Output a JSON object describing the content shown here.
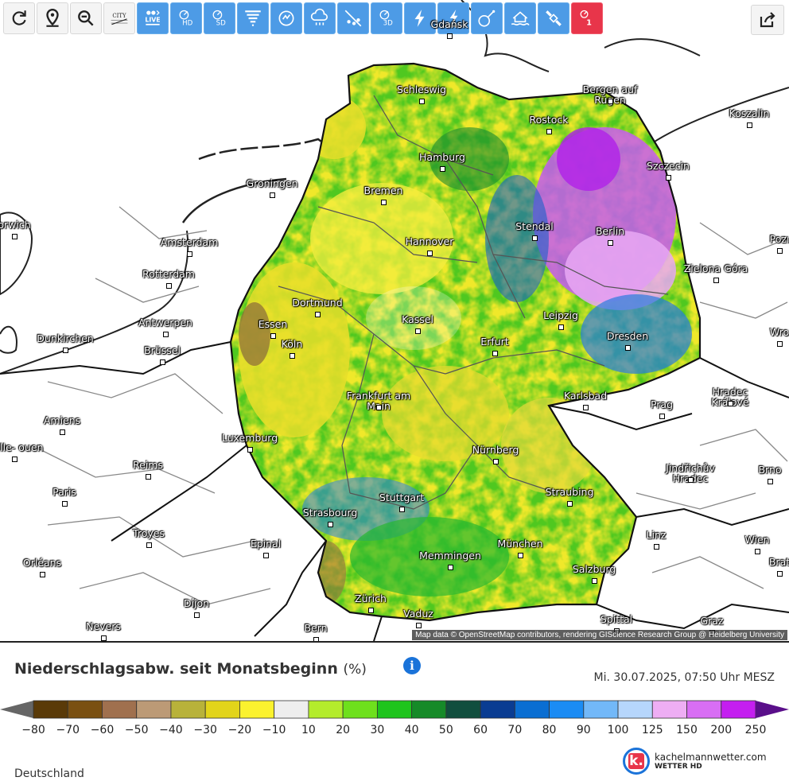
{
  "toolbar": {
    "buttons": [
      {
        "name": "refresh-button",
        "icon": "refresh-icon",
        "style": "white"
      },
      {
        "name": "location-button",
        "icon": "location-pin-icon",
        "style": "white"
      },
      {
        "name": "zoom-out-button",
        "icon": "zoom-out-icon",
        "style": "white"
      },
      {
        "name": "city-toggle-button",
        "icon": "city-icon",
        "style": "white",
        "label": "CITY"
      },
      {
        "name": "live-analyse-button",
        "icon": "live-icon",
        "style": "blue",
        "label": "LIVE"
      },
      {
        "name": "radar-hd-button",
        "icon": "radar-hd-icon",
        "style": "blue",
        "label": "HD"
      },
      {
        "name": "radar-sd-button",
        "icon": "radar-sd-icon",
        "style": "blue",
        "label": "SD"
      },
      {
        "name": "tornado-button",
        "icon": "tornado-icon",
        "style": "blue"
      },
      {
        "name": "storm-track-button",
        "icon": "storm-track-icon",
        "style": "blue"
      },
      {
        "name": "precipitation-button",
        "icon": "rain-cloud-icon",
        "style": "blue"
      },
      {
        "name": "hail-button",
        "icon": "hail-icon",
        "style": "blue"
      },
      {
        "name": "radar-3d-button",
        "icon": "radar-3d-icon",
        "style": "blue",
        "label": "3D"
      },
      {
        "name": "lightning-button",
        "icon": "lightning-icon",
        "style": "blue"
      },
      {
        "name": "lightning-ground-button",
        "icon": "lightning-ground-icon",
        "style": "blue"
      },
      {
        "name": "satellite-dish-button",
        "icon": "satellite-dish-icon",
        "style": "blue"
      },
      {
        "name": "flood-button",
        "icon": "flood-icon",
        "style": "blue"
      },
      {
        "name": "satellite-button",
        "icon": "satellite-icon",
        "style": "blue"
      },
      {
        "name": "warning-button",
        "icon": "warning-radar-icon",
        "style": "red",
        "label": "1"
      }
    ]
  },
  "map": {
    "attribution": "Map data © OpenStreetMap contributors, rendering GIScience Research Group @ Heidelberg University",
    "cities": [
      {
        "name": "Gdańsk",
        "label": "Gdańsk"
      },
      {
        "name": "Schleswig",
        "label": "Schleswig"
      },
      {
        "name": "Bergen auf Rügen",
        "label": "Bergen auf Rügen"
      },
      {
        "name": "Rostock",
        "label": "Rostock"
      },
      {
        "name": "Koszalin",
        "label": "Koszalin"
      },
      {
        "name": "Hamburg",
        "label": "Hamburg"
      },
      {
        "name": "Szczecin",
        "label": "Szczecin"
      },
      {
        "name": "Groningen",
        "label": "Groningen"
      },
      {
        "name": "Bremen",
        "label": "Bremen"
      },
      {
        "name": "Norwich",
        "label": "orwich"
      },
      {
        "name": "Stendal",
        "label": "Stendal"
      },
      {
        "name": "Amsterdam",
        "label": "Amsterdam"
      },
      {
        "name": "Berlin",
        "label": "Berlin"
      },
      {
        "name": "Hannover",
        "label": "Hannover"
      },
      {
        "name": "Poznań",
        "label": "Pozı"
      },
      {
        "name": "Zielona Góra",
        "label": "Zielona Góra"
      },
      {
        "name": "Rotterdam",
        "label": "Rotterdam"
      },
      {
        "name": "Dortmund",
        "label": "Dortmund"
      },
      {
        "name": "Antwerpen",
        "label": "Antwerpen"
      },
      {
        "name": "Essen",
        "label": "Essen"
      },
      {
        "name": "Kassel",
        "label": "Kassel"
      },
      {
        "name": "Leipzig",
        "label": "Leipzig"
      },
      {
        "name": "Wrocław",
        "label": "Wro"
      },
      {
        "name": "Dunkirchen",
        "label": "Dunkirchen"
      },
      {
        "name": "Brüssel",
        "label": "Brüssel"
      },
      {
        "name": "Köln",
        "label": "Köln"
      },
      {
        "name": "Erfurt",
        "label": "Erfurt"
      },
      {
        "name": "Dresden",
        "label": "Dresden"
      },
      {
        "name": "Frankfurt am Main",
        "label": "Frankfurt am Main"
      },
      {
        "name": "Hradec Králové",
        "label": "Hradec Králové"
      },
      {
        "name": "Karlsbad",
        "label": "Karlsbad"
      },
      {
        "name": "Prag",
        "label": "Prag"
      },
      {
        "name": "Amiens",
        "label": "Amiens"
      },
      {
        "name": "Luxemburg",
        "label": "Luxemburg"
      },
      {
        "name": "Rouen",
        "label": "eville- ouen"
      },
      {
        "name": "Nürnberg",
        "label": "Nürnberg"
      },
      {
        "name": "Jindřichův Hradec",
        "label": "Jindřichův Hradec"
      },
      {
        "name": "Reims",
        "label": "Reims"
      },
      {
        "name": "Brno",
        "label": "Brno"
      },
      {
        "name": "Paris",
        "label": "Paris"
      },
      {
        "name": "Stuttgart",
        "label": "Stuttgart"
      },
      {
        "name": "Straubing",
        "label": "Straubing"
      },
      {
        "name": "Strasbourg",
        "label": "Strasbourg"
      },
      {
        "name": "Troyes",
        "label": "Troyes"
      },
      {
        "name": "Epinal",
        "label": "Epinal"
      },
      {
        "name": "Linz",
        "label": "Linz"
      },
      {
        "name": "München",
        "label": "München"
      },
      {
        "name": "Wien",
        "label": "Wien"
      },
      {
        "name": "Orléans",
        "label": "Orléans"
      },
      {
        "name": "Memmingen",
        "label": "Memmingen"
      },
      {
        "name": "Salzburg",
        "label": "Salzburg"
      },
      {
        "name": "Bratislava",
        "label": "Brat"
      },
      {
        "name": "Zürich",
        "label": "Zürich"
      },
      {
        "name": "Dijon",
        "label": "Dijon"
      },
      {
        "name": "Vaduz",
        "label": "Vaduz"
      },
      {
        "name": "Nevers",
        "label": "Nevers"
      },
      {
        "name": "Bern",
        "label": "Bern"
      },
      {
        "name": "Spittal",
        "label": "Spittal"
      },
      {
        "name": "Graz",
        "label": "Graz"
      }
    ]
  },
  "legend": {
    "title": "Niederschlagsabw. seit Monatsbeginn",
    "unit": "(%)",
    "datetime": "Mi. 30.07.2025, 07:50 Uhr MESZ",
    "region": "Deutschland",
    "colors": [
      "#5a3a08",
      "#7a5012",
      "#a0704e",
      "#bc9a76",
      "#b8b23a",
      "#e2d41a",
      "#fbf22e",
      "#eeeeee",
      "#b4ec2c",
      "#6ee01c",
      "#1ec41c",
      "#168a28",
      "#114e3e",
      "#0a3c92",
      "#0a6ed2",
      "#1b8cf4",
      "#72b8f8",
      "#b6d6fc",
      "#eeaef4",
      "#d86ef4",
      "#c41ef0"
    ],
    "ticks": [
      "−80",
      "−70",
      "−60",
      "−50",
      "−40",
      "−30",
      "−20",
      "−10",
      "10",
      "20",
      "30",
      "40",
      "50",
      "60",
      "70",
      "80",
      "90",
      "100",
      "125",
      "150",
      "200",
      "250"
    ]
  },
  "logo": {
    "brand": "kachelmannwetter.com",
    "sub": "WETTER HD",
    "letter": "k."
  }
}
